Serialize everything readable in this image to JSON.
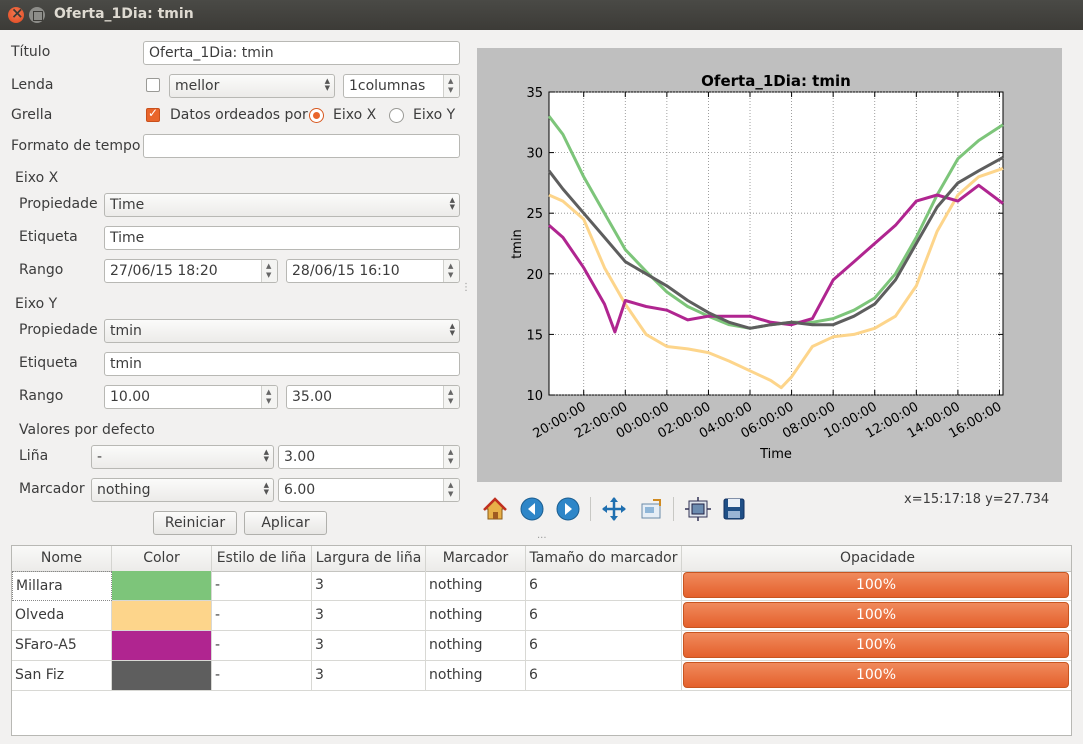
{
  "window": {
    "title": "Oferta_1Dia: tmin"
  },
  "form": {
    "titulo_label": "Título",
    "titulo_value": "Oferta_1Dia: tmin",
    "lenda_label": "Lenda",
    "lenda_checked": false,
    "lenda_position": "mellor",
    "lenda_columns": "1columnas",
    "grella_label": "Grella",
    "grella_checked": true,
    "datos_ordeados_label": "Datos ordeados por",
    "eixo_x_radio": "Eixo X",
    "eixo_y_radio": "Eixo Y",
    "eixo_selected": "Eixo X",
    "formato_tempo_label": "Formato de tempo",
    "formato_tempo_value": "",
    "eixo_x": {
      "section": "Eixo X",
      "propiedade_label": "Propiedade",
      "propiedade_value": "Time",
      "etiqueta_label": "Etiqueta",
      "etiqueta_value": "Time",
      "rango_label": "Rango",
      "rango_min": "27/06/15 18:20",
      "rango_max": "28/06/15 16:10"
    },
    "eixo_y": {
      "section": "Eixo Y",
      "propiedade_label": "Propiedade",
      "propiedade_value": "tmin",
      "etiqueta_label": "Etiqueta",
      "etiqueta_value": "tmin",
      "rango_label": "Rango",
      "rango_min": "10.00",
      "rango_max": "35.00"
    },
    "defaults": {
      "section": "Valores por defecto",
      "linea_label": "Liña",
      "linea_style": "-",
      "linea_width": "3.00",
      "marcador_label": "Marcador",
      "marcador_value": "nothing",
      "marcador_size": "6.00"
    },
    "reiniciar": "Reiniciar",
    "aplicar": "Aplicar"
  },
  "toolbar": {
    "icons": [
      "home-icon",
      "back-icon",
      "forward-icon",
      "pan-icon",
      "zoom-icon",
      "configure-subplots-icon",
      "save-icon"
    ],
    "coords": "x=15:17:18 y=27.734"
  },
  "chart_data": {
    "type": "line",
    "title": "Oferta_1Dia: tmin",
    "xlabel": "Time",
    "ylabel": "tmin",
    "ylim": [
      10,
      35
    ],
    "yticks": [
      "10",
      "15",
      "20",
      "25",
      "30",
      "35"
    ],
    "xticks": [
      "20:00:00",
      "22:00:00",
      "00:00:00",
      "02:00:00",
      "04:00:00",
      "06:00:00",
      "08:00:00",
      "10:00:00",
      "12:00:00",
      "14:00:00",
      "16:00:00"
    ],
    "x_range_hours": [
      18.33,
      40.17
    ],
    "grid": true,
    "series": [
      {
        "name": "Millara",
        "color": "#7dc57a",
        "x": [
          18.33,
          19.0,
          20.0,
          21.0,
          22.0,
          23.0,
          24.0,
          25.0,
          26.0,
          27.0,
          28.0,
          29.0,
          30.0,
          31.0,
          32.0,
          33.0,
          34.0,
          35.0,
          36.0,
          37.0,
          38.0,
          39.0,
          40.17
        ],
        "y": [
          33.0,
          31.5,
          28.0,
          25.0,
          22.0,
          20.2,
          18.5,
          17.3,
          16.5,
          15.8,
          15.5,
          15.8,
          16.0,
          16.0,
          16.3,
          17.0,
          18.0,
          20.0,
          23.0,
          26.5,
          29.5,
          31.0,
          32.3
        ]
      },
      {
        "name": "Olveda",
        "color": "#fdd58b",
        "x": [
          18.33,
          19.0,
          20.0,
          21.0,
          22.0,
          23.0,
          24.0,
          25.0,
          26.0,
          27.0,
          28.0,
          29.0,
          29.5,
          30.0,
          31.0,
          32.0,
          33.0,
          34.0,
          35.0,
          36.0,
          37.0,
          38.0,
          39.0,
          40.17
        ],
        "y": [
          26.5,
          26.0,
          24.5,
          20.5,
          17.5,
          15.0,
          14.0,
          13.8,
          13.5,
          12.8,
          12.0,
          11.2,
          10.6,
          11.5,
          14.0,
          14.8,
          15.0,
          15.5,
          16.5,
          19.0,
          23.5,
          26.5,
          28.0,
          28.7
        ]
      },
      {
        "name": "SFaro-A5",
        "color": "#b02590",
        "x": [
          18.33,
          19.0,
          20.0,
          21.0,
          21.5,
          22.0,
          23.0,
          24.0,
          25.0,
          26.0,
          27.0,
          28.0,
          29.0,
          30.0,
          31.0,
          32.0,
          33.0,
          34.0,
          35.0,
          36.0,
          37.0,
          38.0,
          39.0,
          40.17
        ],
        "y": [
          24.0,
          23.0,
          20.5,
          17.5,
          15.2,
          17.8,
          17.3,
          17.0,
          16.2,
          16.5,
          16.5,
          16.5,
          16.0,
          15.8,
          16.3,
          19.5,
          21.0,
          22.5,
          24.0,
          26.0,
          26.5,
          26.0,
          27.3,
          25.8
        ]
      },
      {
        "name": "San Fiz",
        "color": "#5e5e5e",
        "x": [
          18.33,
          19.0,
          20.0,
          21.0,
          22.0,
          23.0,
          24.0,
          25.0,
          26.0,
          27.0,
          28.0,
          29.0,
          30.0,
          31.0,
          32.0,
          33.0,
          34.0,
          35.0,
          36.0,
          37.0,
          38.0,
          39.0,
          40.17
        ],
        "y": [
          28.5,
          27.0,
          25.0,
          23.0,
          21.0,
          20.0,
          19.0,
          17.8,
          16.8,
          16.0,
          15.5,
          15.8,
          16.0,
          15.8,
          15.8,
          16.5,
          17.5,
          19.5,
          22.5,
          25.5,
          27.5,
          28.5,
          29.6
        ]
      }
    ]
  },
  "table": {
    "headers": [
      "Nome",
      "Color",
      "Estilo de liña",
      "Largura de liña",
      "Marcador",
      "Tamaño do marcador",
      "Opacidade"
    ],
    "rows": [
      {
        "nome": "Millara",
        "color": "#7dc57a",
        "estilo": "-",
        "largura": "3",
        "marcador": "nothing",
        "tamano": "6",
        "opacidade": "100%",
        "opacidade_value": 1.0
      },
      {
        "nome": "Olveda",
        "color": "#fdd58b",
        "estilo": "-",
        "largura": "3",
        "marcador": "nothing",
        "tamano": "6",
        "opacidade": "100%",
        "opacidade_value": 1.0
      },
      {
        "nome": "SFaro-A5",
        "color": "#b02590",
        "estilo": "-",
        "largura": "3",
        "marcador": "nothing",
        "tamano": "6",
        "opacidade": "100%",
        "opacidade_value": 1.0
      },
      {
        "nome": "San Fiz",
        "color": "#5e5e5e",
        "estilo": "-",
        "largura": "3",
        "marcador": "nothing",
        "tamano": "6",
        "opacidade": "100%",
        "opacidade_value": 1.0
      }
    ]
  }
}
